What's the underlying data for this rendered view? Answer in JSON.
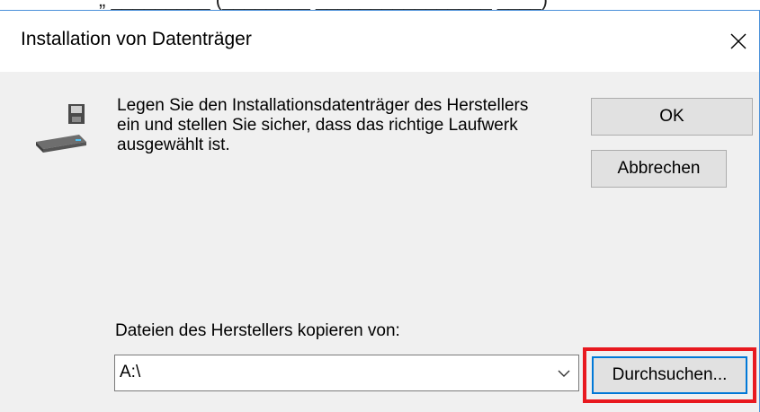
{
  "dialog": {
    "title": "Installation von Datenträger",
    "message": "Legen Sie den Installationsdatenträger des Herstellers\nein und stellen Sie sicher, dass das richtige Laufwerk\nausgewählt ist.",
    "ok_label": "OK",
    "cancel_label": "Abbrechen",
    "copy_from_label": "Dateien des Herstellers kopieren von:",
    "path_value": "A:\\",
    "browse_label": "Durchsuchen...",
    "close_glyph": "✕"
  },
  "icons": {
    "close": "close-icon",
    "disk": "disk-drive-icon",
    "dropdown": "chevron-down-icon"
  },
  "colors": {
    "focus_border": "#0078d7",
    "highlight": "#e8191f",
    "dialog_bg": "#f0f0f0"
  }
}
